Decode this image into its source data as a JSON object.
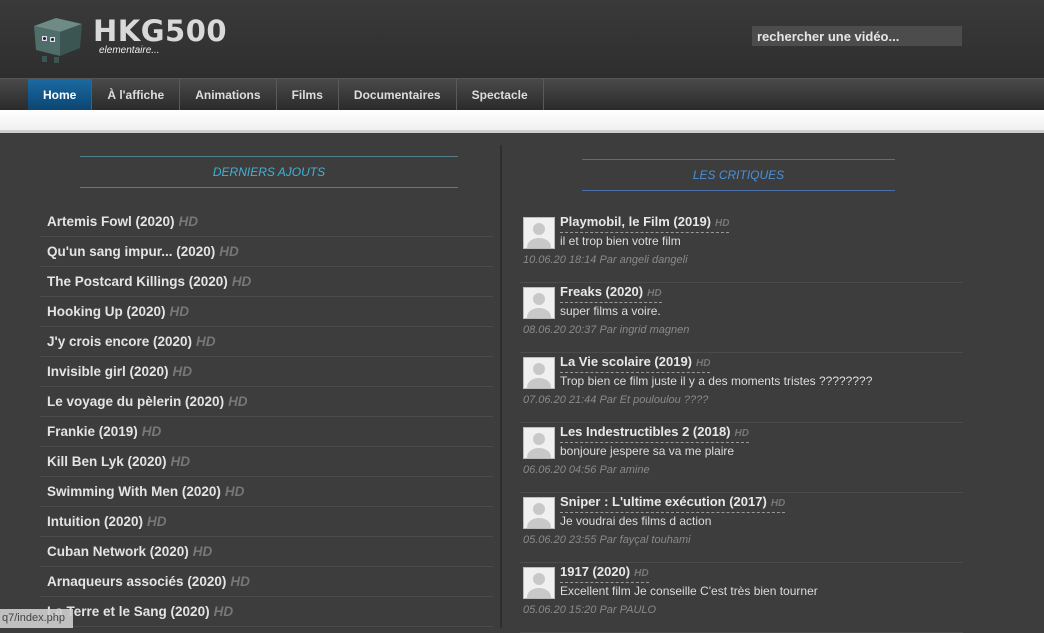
{
  "header": {
    "title": "HKG500",
    "subtitle": "elementaire...",
    "logo_icon": "robot-box-icon",
    "search_placeholder": "rechercher une vidéo..."
  },
  "nav": {
    "items": [
      "Home",
      "À l'affiche",
      "Animations",
      "Films",
      "Documentaires",
      "Spectacle"
    ],
    "active": "Home",
    "active_color": "#0e5a91"
  },
  "recent": {
    "title": "DERNIERS AJOUTS",
    "badge": "HD",
    "items": [
      "Artemis Fowl (2020)",
      "Qu'un sang impur... (2020)",
      "The Postcard Killings (2020)",
      "Hooking Up (2020)",
      "J'y crois encore (2020)",
      "Invisible girl (2020)",
      "Le voyage du pèlerin (2020)",
      "Frankie (2019)",
      "Kill Ben Lyk (2020)",
      "Swimming With Men (2020)",
      "Intuition (2020)",
      "Cuban Network (2020)",
      "Arnaqueurs associés (2020)",
      "La Terre et le Sang (2020)"
    ]
  },
  "reviews": {
    "title": "LES CRITIQUES",
    "badge": "HD",
    "items": [
      {
        "film": "Playmobil, le Film (2019)",
        "text": "il et trop bien votre film",
        "meta": "10.06.20 18:14 Par angeli dangeli"
      },
      {
        "film": "Freaks (2020)",
        "text": "super films a voire.",
        "meta": "08.06.20 20:37 Par ingrid magnen"
      },
      {
        "film": "La Vie scolaire (2019)",
        "text": "Trop bien ce film juste il y a des moments tristes ????????",
        "meta": "07.06.20 21:44 Par Et pouloulou ????"
      },
      {
        "film": "Les Indestructibles 2 (2018)",
        "text": "bonjoure jespere sa va me plaire",
        "meta": "06.06.20 04:56 Par amine"
      },
      {
        "film": "Sniper : L'ultime exécution (2017)",
        "text": "Je voudrai des films d action",
        "meta": "05.06.20 23:55 Par fayçal touhami"
      },
      {
        "film": "1917 (2020)",
        "text": "Excellent film Je conseille C'est très bien tourner",
        "meta": "05.06.20 15:20 Par PAULO"
      }
    ]
  },
  "status_bar": "q7/index.php"
}
